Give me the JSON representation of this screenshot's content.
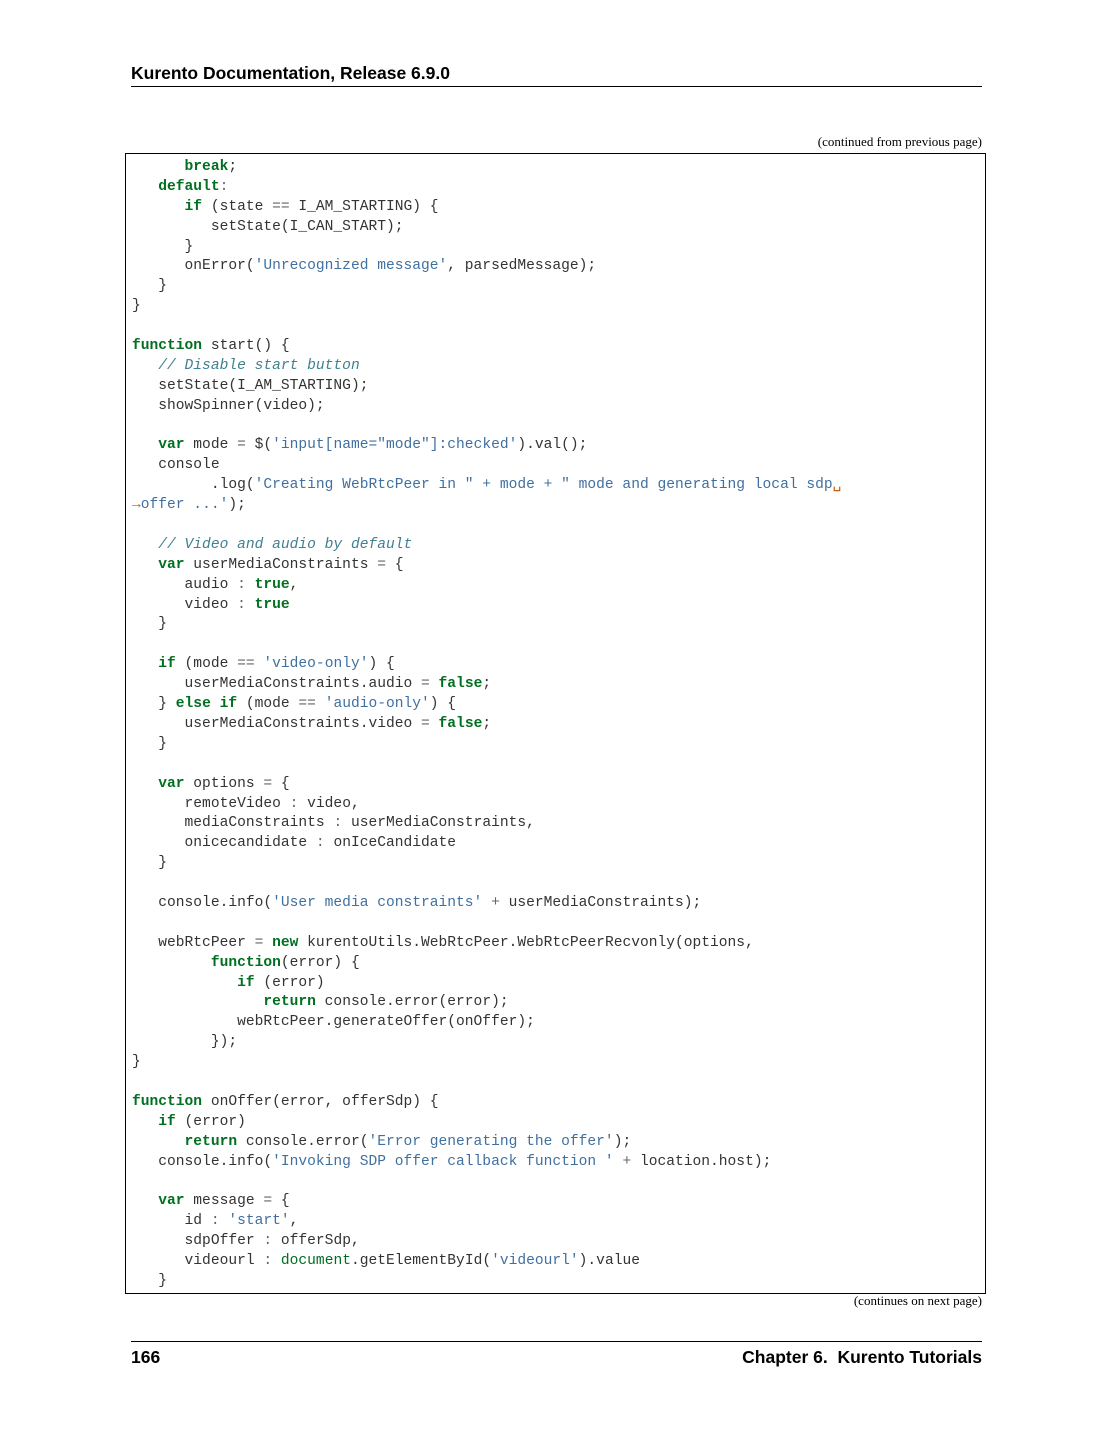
{
  "header": {
    "title": "Kurento Documentation, Release 6.9.0"
  },
  "continued_from_label": "(continued from previous page)",
  "continues_on_label": "(continues on next page)",
  "footer": {
    "page_number": "166",
    "chapter_title": "Chapter 6.  Kurento Tutorials"
  },
  "code_colors": {
    "keyword": "#007020",
    "string": "#4070a0",
    "comment": "#408090",
    "operator": "#666666",
    "plain": "#333333",
    "continuation_marker": "#c65d09"
  },
  "code_lines": [
    [
      [
        "kw",
        "      break"
      ],
      [
        "pl",
        ";"
      ]
    ],
    [
      [
        "kw",
        "   default"
      ],
      [
        "op",
        ":"
      ]
    ],
    [
      [
        "kw",
        "      if"
      ],
      [
        "pl",
        " (state "
      ],
      [
        "op",
        "=="
      ],
      [
        "pl",
        " I_AM_STARTING) {"
      ]
    ],
    [
      [
        "pl",
        "         setState(I_CAN_START);"
      ]
    ],
    [
      [
        "pl",
        "      }"
      ]
    ],
    [
      [
        "pl",
        "      onError("
      ],
      [
        "str",
        "'Unrecognized message'"
      ],
      [
        "pl",
        ", parsedMessage);"
      ]
    ],
    [
      [
        "pl",
        "   }"
      ]
    ],
    [
      [
        "pl",
        "}"
      ]
    ],
    [],
    [
      [
        "kw",
        "function"
      ],
      [
        "pl",
        " start() {"
      ]
    ],
    [
      [
        "cm",
        "   // Disable start button"
      ]
    ],
    [
      [
        "pl",
        "   setState(I_AM_STARTING);"
      ]
    ],
    [
      [
        "pl",
        "   showSpinner(video);"
      ]
    ],
    [],
    [
      [
        "kw",
        "   var"
      ],
      [
        "pl",
        " mode "
      ],
      [
        "op",
        "="
      ],
      [
        "pl",
        " $("
      ],
      [
        "str",
        "'input[name=\"mode\"]:checked'"
      ],
      [
        "pl",
        ").val();"
      ]
    ],
    [
      [
        "pl",
        "   console"
      ]
    ],
    [
      [
        "pl",
        "         .log("
      ],
      [
        "str",
        "'Creating WebRtcPeer in \" + mode + \" mode and generating local sdp"
      ],
      [
        "cont",
        "␣"
      ]
    ],
    [
      [
        "cont",
        "→"
      ],
      [
        "str",
        "offer ...'"
      ],
      [
        "pl",
        ");"
      ]
    ],
    [],
    [
      [
        "cm",
        "   // Video and audio by default"
      ]
    ],
    [
      [
        "kw",
        "   var"
      ],
      [
        "pl",
        " userMediaConstraints "
      ],
      [
        "op",
        "="
      ],
      [
        "pl",
        " {"
      ]
    ],
    [
      [
        "pl",
        "      audio "
      ],
      [
        "op",
        ":"
      ],
      [
        "pl",
        " "
      ],
      [
        "kw",
        "true"
      ],
      [
        "pl",
        ","
      ]
    ],
    [
      [
        "pl",
        "      video "
      ],
      [
        "op",
        ":"
      ],
      [
        "pl",
        " "
      ],
      [
        "kw",
        "true"
      ]
    ],
    [
      [
        "pl",
        "   }"
      ]
    ],
    [],
    [
      [
        "kw",
        "   if"
      ],
      [
        "pl",
        " (mode "
      ],
      [
        "op",
        "=="
      ],
      [
        "pl",
        " "
      ],
      [
        "str",
        "'video-only'"
      ],
      [
        "pl",
        ") {"
      ]
    ],
    [
      [
        "pl",
        "      userMediaConstraints.audio "
      ],
      [
        "op",
        "="
      ],
      [
        "pl",
        " "
      ],
      [
        "kw",
        "false"
      ],
      [
        "pl",
        ";"
      ]
    ],
    [
      [
        "pl",
        "   } "
      ],
      [
        "kw",
        "else if"
      ],
      [
        "pl",
        " (mode "
      ],
      [
        "op",
        "=="
      ],
      [
        "pl",
        " "
      ],
      [
        "str",
        "'audio-only'"
      ],
      [
        "pl",
        ") {"
      ]
    ],
    [
      [
        "pl",
        "      userMediaConstraints.video "
      ],
      [
        "op",
        "="
      ],
      [
        "pl",
        " "
      ],
      [
        "kw",
        "false"
      ],
      [
        "pl",
        ";"
      ]
    ],
    [
      [
        "pl",
        "   }"
      ]
    ],
    [],
    [
      [
        "kw",
        "   var"
      ],
      [
        "pl",
        " options "
      ],
      [
        "op",
        "="
      ],
      [
        "pl",
        " {"
      ]
    ],
    [
      [
        "pl",
        "      remoteVideo "
      ],
      [
        "op",
        ":"
      ],
      [
        "pl",
        " video,"
      ]
    ],
    [
      [
        "pl",
        "      mediaConstraints "
      ],
      [
        "op",
        ":"
      ],
      [
        "pl",
        " userMediaConstraints,"
      ]
    ],
    [
      [
        "pl",
        "      onicecandidate "
      ],
      [
        "op",
        ":"
      ],
      [
        "pl",
        " onIceCandidate"
      ]
    ],
    [
      [
        "pl",
        "   }"
      ]
    ],
    [],
    [
      [
        "pl",
        "   console.info("
      ],
      [
        "str",
        "'User media constraints'"
      ],
      [
        "pl",
        " "
      ],
      [
        "op",
        "+"
      ],
      [
        "pl",
        " userMediaConstraints);"
      ]
    ],
    [],
    [
      [
        "pl",
        "   webRtcPeer "
      ],
      [
        "op",
        "="
      ],
      [
        "pl",
        " "
      ],
      [
        "kw",
        "new"
      ],
      [
        "pl",
        " kurentoUtils.WebRtcPeer.WebRtcPeerRecvonly(options,"
      ]
    ],
    [
      [
        "kw",
        "         function"
      ],
      [
        "pl",
        "(error) {"
      ]
    ],
    [
      [
        "kw",
        "            if"
      ],
      [
        "pl",
        " (error)"
      ]
    ],
    [
      [
        "kw",
        "               return"
      ],
      [
        "pl",
        " console.error(error);"
      ]
    ],
    [
      [
        "pl",
        "            webRtcPeer.generateOffer(onOffer);"
      ]
    ],
    [
      [
        "pl",
        "         });"
      ]
    ],
    [
      [
        "pl",
        "}"
      ]
    ],
    [],
    [
      [
        "kw",
        "function"
      ],
      [
        "pl",
        " onOffer(error, offerSdp) {"
      ]
    ],
    [
      [
        "kw",
        "   if"
      ],
      [
        "pl",
        " (error)"
      ]
    ],
    [
      [
        "kw",
        "      return"
      ],
      [
        "pl",
        " console.error("
      ],
      [
        "str",
        "'Error generating the offer'"
      ],
      [
        "pl",
        ");"
      ]
    ],
    [
      [
        "pl",
        "   console.info("
      ],
      [
        "str",
        "'Invoking SDP offer callback function '"
      ],
      [
        "pl",
        " "
      ],
      [
        "op",
        "+"
      ],
      [
        "pl",
        " location.host);"
      ]
    ],
    [],
    [
      [
        "kw",
        "   var"
      ],
      [
        "pl",
        " message "
      ],
      [
        "op",
        "="
      ],
      [
        "pl",
        " {"
      ]
    ],
    [
      [
        "pl",
        "      id "
      ],
      [
        "op",
        ":"
      ],
      [
        "pl",
        " "
      ],
      [
        "str",
        "'start'"
      ],
      [
        "pl",
        ","
      ]
    ],
    [
      [
        "pl",
        "      sdpOffer "
      ],
      [
        "op",
        ":"
      ],
      [
        "pl",
        " offerSdp,"
      ]
    ],
    [
      [
        "pl",
        "      videourl "
      ],
      [
        "op",
        ":"
      ],
      [
        "pl",
        " "
      ],
      [
        "bi",
        "document"
      ],
      [
        "pl",
        ".getElementById("
      ],
      [
        "str",
        "'videourl'"
      ],
      [
        "pl",
        ").value"
      ]
    ],
    [
      [
        "pl",
        "   }"
      ]
    ]
  ]
}
